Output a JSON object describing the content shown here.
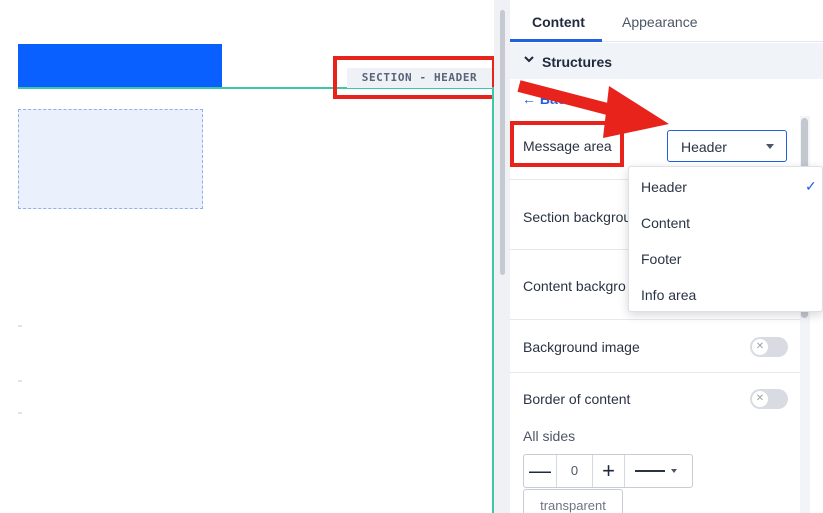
{
  "canvas": {
    "section_tag": "SECTION - HEADER"
  },
  "panel": {
    "tabs": [
      {
        "label": "Content",
        "active": true
      },
      {
        "label": "Appearance",
        "active": false
      }
    ],
    "structures": {
      "chevron": "chevron-down-icon",
      "label": "Structures"
    },
    "back": {
      "icon": "arrow-left-icon",
      "label": "Back"
    },
    "message_area": {
      "label": "Message area",
      "selected": "Header"
    },
    "rows": {
      "section_background": "Section backgrou",
      "content_background": "Content backgro",
      "background_image": "Background image",
      "border_of_content": "Border of content"
    },
    "border": {
      "all_sides_label": "All sides",
      "minus": "—",
      "width_value": "0",
      "plus": "+",
      "color_label": "transparent"
    },
    "toggles": {
      "background_image_on": false,
      "border_of_content_on": false
    }
  },
  "dropdown": {
    "options": [
      "Header",
      "Content",
      "Footer",
      "Info area"
    ],
    "selected_index": 0,
    "check_icon": "checkmark-icon"
  },
  "colors": {
    "accent": "#1f5fe0",
    "header_block": "#0a60ff",
    "section_outline": "#3ec7a5",
    "annotation_red": "#e8231b"
  }
}
